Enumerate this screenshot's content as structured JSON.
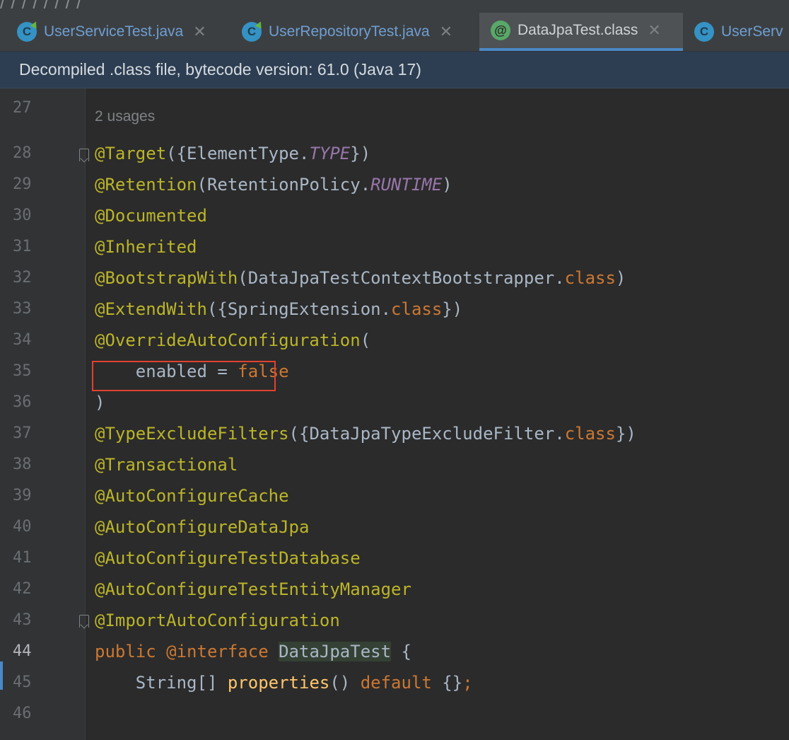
{
  "tabs": [
    {
      "label": "UserServiceTest.java",
      "icon": "class-icon",
      "active": false
    },
    {
      "label": "UserRepositoryTest.java",
      "icon": "class-icon",
      "active": false
    },
    {
      "label": "DataJpaTest.class",
      "icon": "annotation-icon",
      "active": true
    },
    {
      "label": "UserServ",
      "icon": "class-icon",
      "active": false
    }
  ],
  "icon_glyphs": {
    "class": "C",
    "annotation": "@"
  },
  "banner": "Decompiled .class file, bytecode version: 61.0 (Java 17)",
  "editor": {
    "top_partial_line_number": "27",
    "usages_hint": "2 usages",
    "lines": [
      {
        "num": "28",
        "tokens": [
          {
            "t": "@Target",
            "c": "ann"
          },
          {
            "t": "({ElementType.",
            "c": "plain"
          },
          {
            "t": "TYPE",
            "c": "cst"
          },
          {
            "t": "})",
            "c": "plain"
          }
        ]
      },
      {
        "num": "29",
        "tokens": [
          {
            "t": "@Retention",
            "c": "ann"
          },
          {
            "t": "(RetentionPolicy.",
            "c": "plain"
          },
          {
            "t": "RUNTIME",
            "c": "cst"
          },
          {
            "t": ")",
            "c": "plain"
          }
        ]
      },
      {
        "num": "30",
        "tokens": [
          {
            "t": "@Documented",
            "c": "ann"
          }
        ]
      },
      {
        "num": "31",
        "tokens": [
          {
            "t": "@Inherited",
            "c": "ann"
          }
        ]
      },
      {
        "num": "32",
        "tokens": [
          {
            "t": "@BootstrapWith",
            "c": "ann"
          },
          {
            "t": "(DataJpaTestContextBootstrapper.",
            "c": "plain"
          },
          {
            "t": "class",
            "c": "kw"
          },
          {
            "t": ")",
            "c": "plain"
          }
        ]
      },
      {
        "num": "33",
        "tokens": [
          {
            "t": "@ExtendWith",
            "c": "ann"
          },
          {
            "t": "({SpringExtension.",
            "c": "plain"
          },
          {
            "t": "class",
            "c": "kw"
          },
          {
            "t": "})",
            "c": "plain"
          }
        ]
      },
      {
        "num": "34",
        "tokens": [
          {
            "t": "@OverrideAutoConfiguration",
            "c": "ann"
          },
          {
            "t": "(",
            "c": "plain"
          }
        ]
      },
      {
        "num": "35",
        "tokens": [
          {
            "t": "    enabled = ",
            "c": "plain"
          },
          {
            "t": "false",
            "c": "kw"
          }
        ]
      },
      {
        "num": "36",
        "tokens": [
          {
            "t": ")",
            "c": "plain"
          }
        ]
      },
      {
        "num": "37",
        "tokens": [
          {
            "t": "@TypeExcludeFilters",
            "c": "ann"
          },
          {
            "t": "({DataJpaTypeExcludeFilter.",
            "c": "plain"
          },
          {
            "t": "class",
            "c": "kw"
          },
          {
            "t": "})",
            "c": "plain"
          }
        ]
      },
      {
        "num": "38",
        "tokens": [
          {
            "t": "@Transactional",
            "c": "ann"
          }
        ]
      },
      {
        "num": "39",
        "tokens": [
          {
            "t": "@AutoConfigureCache",
            "c": "ann"
          }
        ]
      },
      {
        "num": "40",
        "tokens": [
          {
            "t": "@AutoConfigureDataJpa",
            "c": "ann"
          }
        ]
      },
      {
        "num": "41",
        "tokens": [
          {
            "t": "@AutoConfigureTestDatabase",
            "c": "ann"
          }
        ]
      },
      {
        "num": "42",
        "tokens": [
          {
            "t": "@AutoConfigureTestEntityManager",
            "c": "ann"
          }
        ]
      },
      {
        "num": "43",
        "tokens": [
          {
            "t": "@ImportAutoConfiguration",
            "c": "ann"
          }
        ]
      },
      {
        "num": "44",
        "current": true,
        "tokens": [
          {
            "t": "public ",
            "c": "kw"
          },
          {
            "t": "@interface ",
            "c": "kw"
          },
          {
            "t": "",
            "c": "cursor"
          },
          {
            "t": "DataJpaTest",
            "c": "plain hl"
          },
          {
            "t": " {",
            "c": "plain"
          }
        ]
      },
      {
        "num": "45",
        "tokens": [
          {
            "t": "    String[] ",
            "c": "plain"
          },
          {
            "t": "properties",
            "c": "fn"
          },
          {
            "t": "() ",
            "c": "plain"
          },
          {
            "t": "default ",
            "c": "kw"
          },
          {
            "t": "{}",
            "c": "plain"
          },
          {
            "t": ";",
            "c": "kw"
          }
        ]
      },
      {
        "num": "46",
        "tokens": []
      }
    ]
  },
  "colors": {
    "annotation": "#bbb529",
    "keyword": "#cc7832",
    "constant": "#9876aa",
    "method": "#ffc66d",
    "plain": "#a9b7c6",
    "highlight_box": "#e04230"
  }
}
